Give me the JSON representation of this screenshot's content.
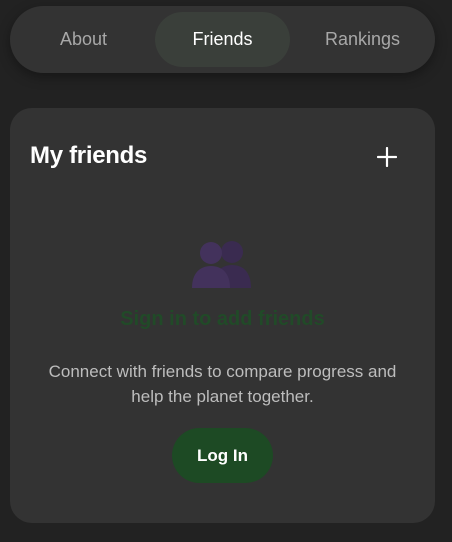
{
  "tabs": {
    "about": "About",
    "friends": "Friends",
    "rankings": "Rankings",
    "active": "Friends"
  },
  "friends_card": {
    "title": "My friends",
    "add_icon": "plus-icon",
    "empty_icon": "people-silhouette-icon",
    "empty_heading": "Sign in to add friends",
    "empty_description": "Connect with friends to compare progress and help the planet together.",
    "login_label": "Log In"
  },
  "colors": {
    "background": "#222222",
    "surface": "#333333",
    "active_tab": "#3a3f3a",
    "primary_green": "#1d4a24",
    "icon_purple": "#3e2e54"
  }
}
